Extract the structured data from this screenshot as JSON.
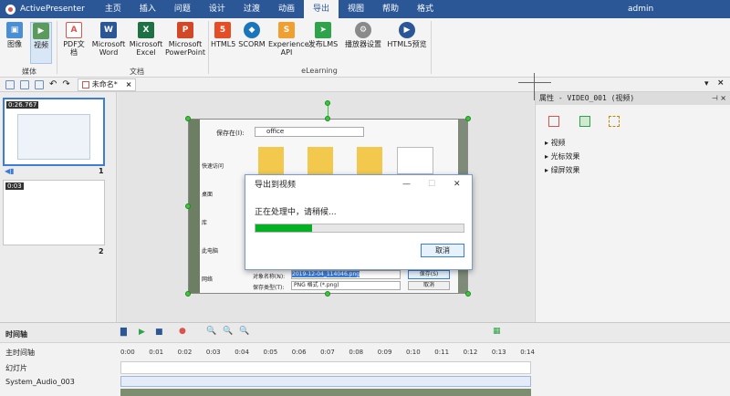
{
  "app": {
    "name": "ActivePresenter",
    "user": "admin"
  },
  "menu": [
    "主页",
    "插入",
    "问题",
    "设计",
    "过渡",
    "动画",
    "导出",
    "视图",
    "帮助",
    "格式"
  ],
  "menu_active_index": 6,
  "ribbon": {
    "buttons": [
      {
        "label": "图像",
        "icon": "image-export-icon"
      },
      {
        "label": "视频",
        "icon": "video-export-icon"
      },
      {
        "label": "PDF文档",
        "icon": "pdf-icon"
      },
      {
        "label": "Microsoft Word",
        "icon": "word-icon"
      },
      {
        "label": "Microsoft Excel",
        "icon": "excel-icon"
      },
      {
        "label": "Microsoft PowerPoint",
        "icon": "powerpoint-icon"
      },
      {
        "label": "HTML5",
        "icon": "html5-icon"
      },
      {
        "label": "SCORM",
        "icon": "scorm-icon"
      },
      {
        "label": "Experience API",
        "icon": "xapi-icon"
      },
      {
        "label": "发布LMS",
        "icon": "publish-lms-icon"
      },
      {
        "label": "播放器设置",
        "icon": "player-settings-icon"
      },
      {
        "label": "HTML5预览",
        "icon": "html5-preview-icon"
      }
    ],
    "groups": [
      "媒体",
      "文档",
      "eLearning"
    ]
  },
  "document_tab": {
    "title": "未命名*",
    "close": "×"
  },
  "slides": [
    {
      "duration": "0:26.767",
      "number": "1"
    },
    {
      "duration": "0:03",
      "number": "2"
    }
  ],
  "embedded_dialog": {
    "save_in_label": "保存在(I):",
    "folder": "office",
    "sidebar": [
      "快速访问",
      "桌面",
      "库",
      "此电脑",
      "网络"
    ],
    "filename_label": "对象名称(N):",
    "filename_value": "2019-12-04_114046.png",
    "filetype_label": "保存类型(T):",
    "filetype_value": "PNG 格式 (*.png)",
    "save_button": "保存(S)",
    "cancel_button": "取消"
  },
  "properties": {
    "header": "属性 - VIDEO_001 (视频)",
    "sections": [
      "视频",
      "光标效果",
      "绿屏效果"
    ]
  },
  "timeline": {
    "title": "时间轴",
    "tracks": [
      "主时间轴",
      "幻灯片",
      "System_Audio_003"
    ],
    "ticks": [
      "0:00",
      "0:01",
      "0:02",
      "0:03",
      "0:04",
      "0:05",
      "0:06",
      "0:07",
      "0:08",
      "0:09",
      "0:10",
      "0:11",
      "0:12",
      "0:13",
      "0:14"
    ]
  },
  "export_dialog": {
    "title": "导出到视频",
    "message": "正在处理中，请稍候...",
    "progress": 0.27,
    "cancel": "取消"
  },
  "colors": {
    "titlebar": "#2b5797",
    "progress": "#06b025",
    "selection": "#3b7dd8",
    "handle": "#3cc63c"
  }
}
